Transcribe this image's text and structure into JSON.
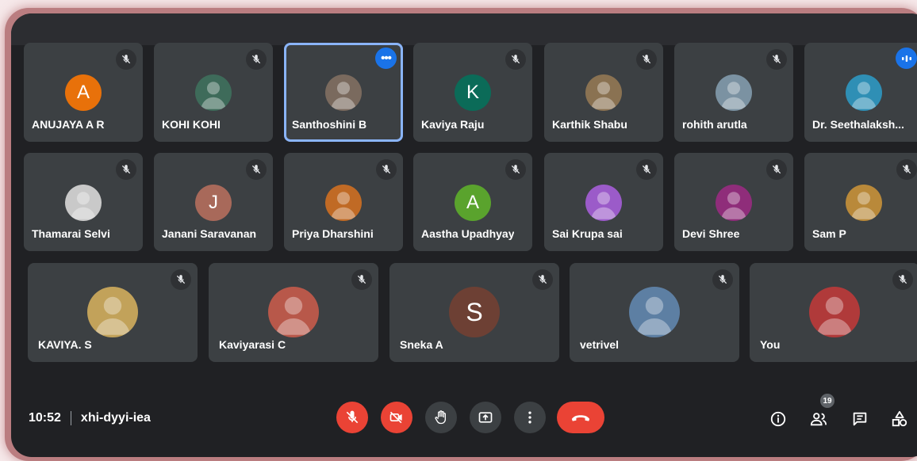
{
  "colors": {
    "tile_bg": "#3c4043",
    "window_bg": "#202124",
    "end_call_red": "#ea4335",
    "active_border": "#8ab4f8",
    "accent_blue": "#1a73e8"
  },
  "participants": [
    {
      "name": "ANUJAYA A R",
      "muted": true,
      "avatar": {
        "type": "initial",
        "letter": "A",
        "color": "#e8710a"
      }
    },
    {
      "name": "KOHI KOHI",
      "muted": true,
      "avatar": {
        "type": "photo",
        "icon": "profile-photo",
        "color": "#3e6b5a"
      }
    },
    {
      "name": "Santhoshini B",
      "muted": false,
      "active": true,
      "more_options": "•••",
      "avatar": {
        "type": "photo",
        "icon": "profile-photo",
        "color": "#7a6a5e"
      }
    },
    {
      "name": "Kaviya Raju",
      "muted": true,
      "avatar": {
        "type": "initial",
        "letter": "K",
        "color": "#0b6b58"
      }
    },
    {
      "name": "Karthik Shabu",
      "muted": true,
      "avatar": {
        "type": "photo",
        "icon": "profile-photo",
        "color": "#8a7252"
      }
    },
    {
      "name": "rohith arutla",
      "muted": true,
      "avatar": {
        "type": "photo",
        "icon": "profile-photo",
        "color": "#7b92a2"
      }
    },
    {
      "name": "Dr. Seethalaksh...",
      "muted": false,
      "avatar": {
        "type": "photo",
        "icon": "profile-photo",
        "color": "#2f8fb5"
      }
    },
    {
      "name": "Thamarai Selvi",
      "muted": true,
      "avatar": {
        "type": "photo",
        "icon": "profile-photo",
        "color": "#c9c9c9"
      }
    },
    {
      "name": "Janani Saravanan",
      "muted": true,
      "avatar": {
        "type": "initial",
        "letter": "J",
        "color": "#a8695a"
      }
    },
    {
      "name": "Priya Dharshini",
      "muted": true,
      "avatar": {
        "type": "photo",
        "icon": "profile-photo",
        "color": "#c06a25"
      }
    },
    {
      "name": "Aastha Upadhyay",
      "muted": true,
      "avatar": {
        "type": "initial",
        "letter": "A",
        "color": "#5aa32d"
      }
    },
    {
      "name": "Sai Krupa sai",
      "muted": true,
      "avatar": {
        "type": "photo",
        "icon": "profile-photo",
        "color": "#9b5bc9"
      }
    },
    {
      "name": "Devi Shree",
      "muted": true,
      "avatar": {
        "type": "photo",
        "icon": "profile-photo",
        "color": "#8f2d7a"
      }
    },
    {
      "name": "Sam P",
      "muted": true,
      "avatar": {
        "type": "photo",
        "icon": "profile-photo",
        "color": "#b9893a"
      }
    },
    {
      "name": "KAVIYA. S",
      "muted": true,
      "avatar": {
        "type": "photo",
        "icon": "profile-photo",
        "color": "#c2a25a"
      }
    },
    {
      "name": "Kaviyarasi C",
      "muted": true,
      "avatar": {
        "type": "photo",
        "icon": "profile-photo",
        "color": "#b8584a"
      }
    },
    {
      "name": "Sneka A",
      "muted": true,
      "avatar": {
        "type": "initial",
        "letter": "S",
        "color": "#6d4034"
      }
    },
    {
      "name": "vetrivel",
      "muted": true,
      "avatar": {
        "type": "photo",
        "icon": "profile-photo",
        "color": "#5d7fa3"
      }
    },
    {
      "name": "You",
      "muted": true,
      "avatar": {
        "type": "photo",
        "icon": "profile-photo",
        "color": "#b03a3a"
      }
    }
  ],
  "meeting": {
    "time": "10:52",
    "code": "xhi-dyyi-iea",
    "people_count": "19"
  },
  "controls": [
    {
      "icon": "mic-off-icon",
      "name": "mic-toggle-button"
    },
    {
      "icon": "camera-off-icon",
      "name": "camera-toggle-button"
    },
    {
      "icon": "raise-hand-icon",
      "name": "raise-hand-button"
    },
    {
      "icon": "present-screen-icon",
      "name": "present-button"
    },
    {
      "icon": "more-options-icon",
      "name": "more-options-button"
    },
    {
      "icon": "end-call-icon",
      "name": "leave-call-button"
    }
  ],
  "right_controls": [
    {
      "icon": "info-icon",
      "name": "meeting-details-button"
    },
    {
      "icon": "people-icon",
      "name": "people-button"
    },
    {
      "icon": "chat-icon",
      "name": "chat-button"
    },
    {
      "icon": "activities-icon",
      "name": "activities-button"
    }
  ]
}
